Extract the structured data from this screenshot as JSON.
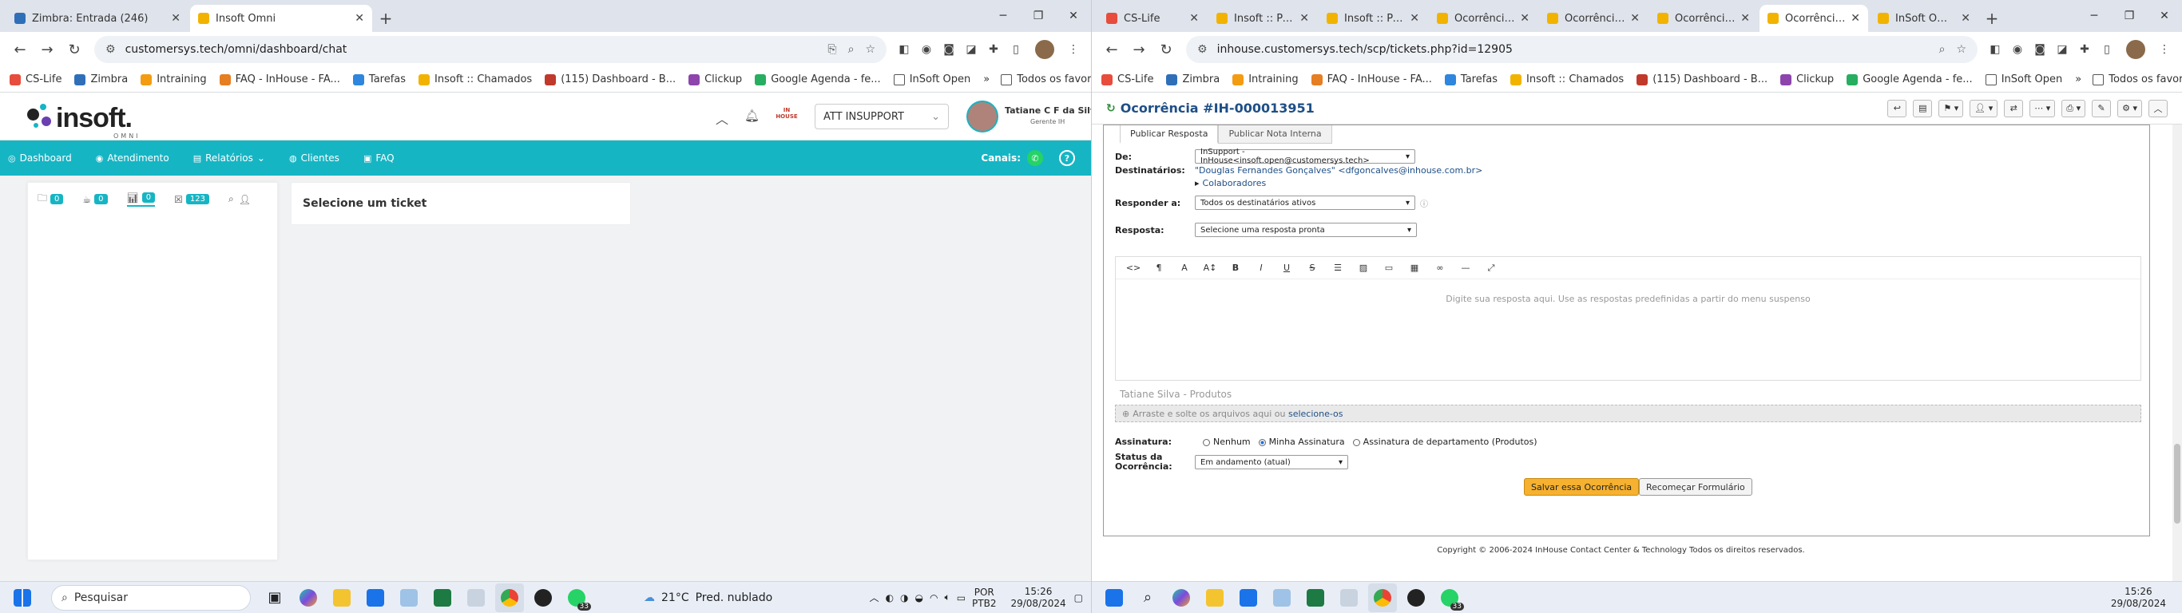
{
  "left_browser": {
    "tabs": [
      {
        "title": "Zimbra: Entrada (246)",
        "color": "#2f6fb8"
      },
      {
        "title": "Insoft Omni",
        "color": "#f2b300"
      }
    ],
    "url": "customersys.tech/omni/dashboard/chat",
    "bookmarks": [
      "CS-Life",
      "Zimbra",
      "Intraining",
      "FAQ - InHouse - FA...",
      "Tarefas",
      "Insoft :: Chamados",
      "(115) Dashboard - B...",
      "Clickup",
      "Google Agenda - fe...",
      "InSoft Open"
    ],
    "bookmarks_more": "»",
    "all_bookmarks": "Todos os favoritos"
  },
  "omni": {
    "brand": "insoft.",
    "brand_sub": "OMNI",
    "team_select": "ATT INSUPPORT",
    "user_name": "Tatiane C F da Silva",
    "user_role": "Gerente IH",
    "house_badge": "IN HOUSE",
    "nav": [
      {
        "label": "Dashboard",
        "glyph": "◎"
      },
      {
        "label": "Atendimento",
        "glyph": "◉"
      },
      {
        "label": "Relatórios",
        "glyph": "▤"
      },
      {
        "label": "Clientes",
        "glyph": "◍"
      },
      {
        "label": "FAQ",
        "glyph": "▣"
      }
    ],
    "channel_label": "Canais:",
    "counters": [
      "0",
      "0",
      "0",
      "123"
    ],
    "select_ticket": "Selecione um ticket"
  },
  "right_browser": {
    "tabs": [
      "CS-Life",
      "Insoft :: Paine",
      "Insoft :: Paine",
      "Ocorrência #",
      "Ocorrência #",
      "Ocorrência #",
      "Ocorrência #",
      "InSoft Omni"
    ],
    "url": "inhouse.customersys.tech/scp/tickets.php?id=12905"
  },
  "ticket": {
    "title": "Ocorrência #IH-000013951",
    "tabs": [
      "Publicar Resposta",
      "Publicar Nota Interna"
    ],
    "from_label": "De:",
    "from_value": "InSupport - InHouse<insoft.open@customersys.tech>",
    "to_label": "Destinatários:",
    "to_value": "\"Douglas Fernandes Gonçalves\" <dfgoncalves@inhouse.com.br>",
    "collaborators": "Colaboradores",
    "reply_to_label": "Responder a:",
    "reply_to_value": "Todos os destinatários ativos",
    "response_label": "Resposta:",
    "response_value": "Selecione uma resposta pronta",
    "editor_placeholder": "Digite sua resposta aqui. Use as respostas predefinidas a partir do menu suspenso",
    "signature_preview": "Tatiane Silva - Produtos",
    "drop_text": "Arraste e solte os arquivos aqui ou",
    "drop_link": "selecione-os",
    "signature_label": "Assinatura:",
    "signature_options": [
      "Nenhum",
      "Minha Assinatura",
      "Assinatura de departamento (Produtos)"
    ],
    "status_label": "Status da Ocorrência:",
    "status_value": "Em andamento (atual)",
    "save_button": "Salvar essa Ocorrência",
    "reset_button": "Recomeçar Formulário",
    "copyright": "Copyright © 2006-2024 InHouse Contact Center & Technology Todos os direitos reservados."
  },
  "taskbar_left": {
    "search": "Pesquisar",
    "weather": "21°C",
    "weather_text": "Pred. nublado",
    "lang1": "POR",
    "lang2": "PTB2",
    "time": "15:26",
    "date": "29/08/2024",
    "badge": "33"
  },
  "taskbar_right": {
    "time": "15:26",
    "date": "29/08/2024",
    "badge": "33"
  }
}
